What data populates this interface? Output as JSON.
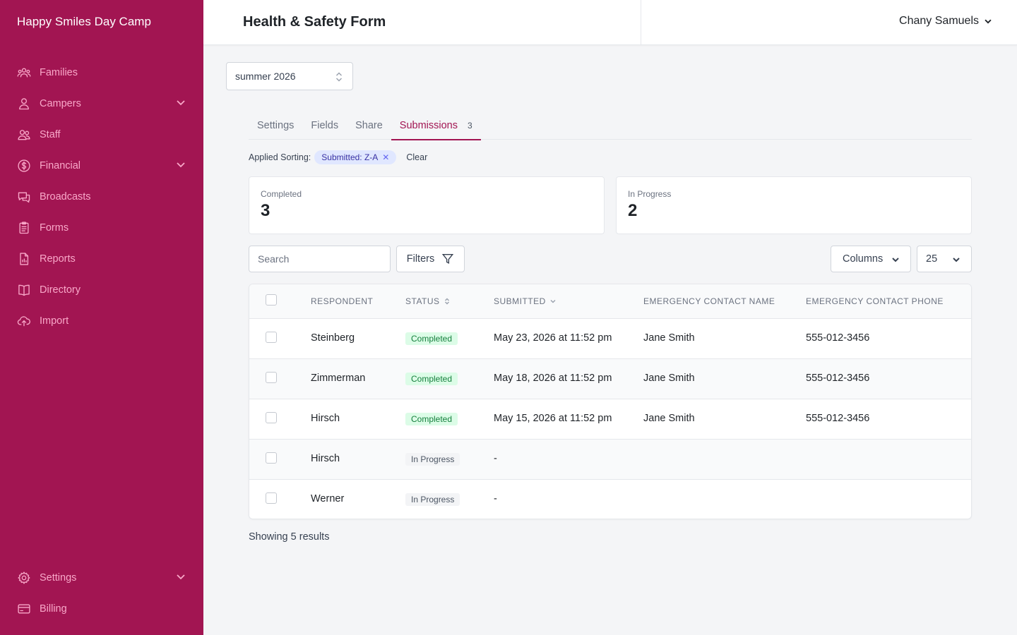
{
  "app": {
    "brand": "Happy Smiles Day Camp"
  },
  "sidebar": {
    "items": [
      {
        "label": "Families",
        "icon": "users-group-icon",
        "chevron": false
      },
      {
        "label": "Campers",
        "icon": "user-icon",
        "chevron": true
      },
      {
        "label": "Staff",
        "icon": "users-icon",
        "chevron": false
      },
      {
        "label": "Financial",
        "icon": "dollar-circle-icon",
        "chevron": true
      },
      {
        "label": "Broadcasts",
        "icon": "chat-bubbles-icon",
        "chevron": false
      },
      {
        "label": "Forms",
        "icon": "clipboard-icon",
        "chevron": false
      },
      {
        "label": "Reports",
        "icon": "report-document-icon",
        "chevron": false
      },
      {
        "label": "Directory",
        "icon": "book-open-icon",
        "chevron": false
      },
      {
        "label": "Import",
        "icon": "cloud-upload-icon",
        "chevron": false
      }
    ],
    "bottom_items": [
      {
        "label": "Settings",
        "icon": "gear-icon",
        "chevron": true
      },
      {
        "label": "Billing",
        "icon": "credit-card-icon",
        "chevron": false
      }
    ]
  },
  "header": {
    "title": "Health & Safety Form",
    "user_name": "Chany Samuels"
  },
  "season": {
    "selected": "summer 2026"
  },
  "tabs": [
    {
      "label": "Settings",
      "count": ""
    },
    {
      "label": "Fields",
      "count": ""
    },
    {
      "label": "Share",
      "count": ""
    },
    {
      "label": "Submissions",
      "count": "3",
      "active": true
    }
  ],
  "sorting": {
    "label": "Applied Sorting:",
    "chip": "Submitted: Z-A",
    "clear": "Clear"
  },
  "stats": {
    "completed": {
      "label": "Completed",
      "value": "3"
    },
    "in_progress": {
      "label": "In Progress",
      "value": "2"
    }
  },
  "toolbar": {
    "search_placeholder": "Search",
    "filters_label": "Filters",
    "columns_label": "Columns",
    "per_page": "25"
  },
  "table": {
    "headers": {
      "respondent": "RESPONDENT",
      "status": "STATUS",
      "submitted": "SUBMITTED",
      "contact_name": "EMERGENCY CONTACT NAME",
      "contact_phone": "EMERGENCY CONTACT PHONE"
    },
    "rows": [
      {
        "respondent": "Steinberg",
        "status": "Completed",
        "submitted": "May 23, 2026 at 11:52 pm",
        "contact_name": "Jane Smith",
        "contact_phone": "555-012-3456"
      },
      {
        "respondent": "Zimmerman",
        "status": "Completed",
        "submitted": "May 18, 2026 at 11:52 pm",
        "contact_name": "Jane Smith",
        "contact_phone": "555-012-3456"
      },
      {
        "respondent": "Hirsch",
        "status": "Completed",
        "submitted": "May 15, 2026 at 11:52 pm",
        "contact_name": "Jane Smith",
        "contact_phone": "555-012-3456"
      },
      {
        "respondent": "Hirsch",
        "status": "In Progress",
        "submitted": "-",
        "contact_name": "",
        "contact_phone": ""
      },
      {
        "respondent": "Werner",
        "status": "In Progress",
        "submitted": "-",
        "contact_name": "",
        "contact_phone": ""
      }
    ]
  },
  "footer": {
    "results": "Showing 5 results"
  },
  "colors": {
    "sidebar_bg": "#a21552",
    "sidebar_text": "#f9a8c9",
    "accent": "#a21552"
  }
}
